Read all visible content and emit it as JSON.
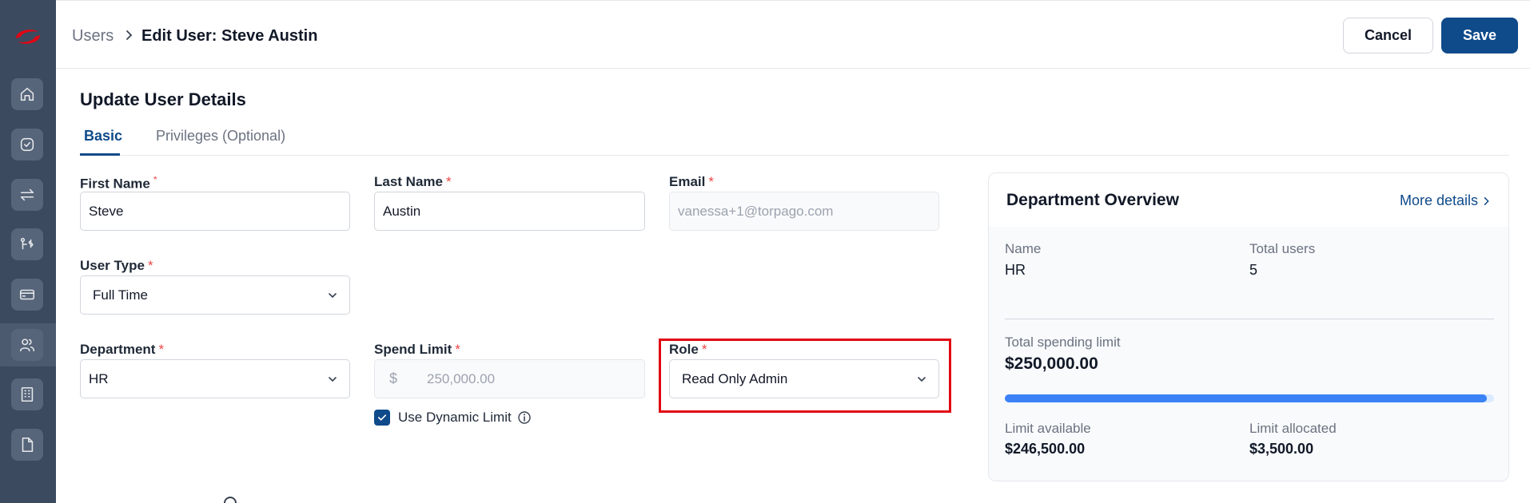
{
  "header": {
    "breadcrumb_root": "Users",
    "breadcrumb_current": "Edit User: Steve Austin",
    "cancel_label": "Cancel",
    "save_label": "Save"
  },
  "sidebar": {
    "items": [
      {
        "icon": "home-icon"
      },
      {
        "icon": "check-circle-icon"
      },
      {
        "icon": "transfer-icon"
      },
      {
        "icon": "routing-dollar-icon"
      },
      {
        "icon": "credit-card-icon"
      },
      {
        "icon": "users-icon",
        "active": true
      },
      {
        "icon": "building-icon"
      },
      {
        "icon": "document-icon"
      }
    ]
  },
  "form": {
    "title": "Update User Details",
    "tabs": [
      {
        "label": "Basic",
        "active": true
      },
      {
        "label": "Privileges (Optional)"
      }
    ],
    "first_name": {
      "label": "First Name",
      "value": "Steve"
    },
    "last_name": {
      "label": "Last Name",
      "value": "Austin"
    },
    "email": {
      "label": "Email",
      "value": "vanessa+1@torpago.com"
    },
    "user_type": {
      "label": "User Type",
      "value": "Full Time"
    },
    "department": {
      "label": "Department",
      "value": "HR"
    },
    "spend_limit": {
      "label": "Spend Limit",
      "currency": "$",
      "value": "250,000.00"
    },
    "dynamic_limit": {
      "label": "Use Dynamic Limit",
      "checked": true
    },
    "role": {
      "label": "Role",
      "value": "Read Only Admin"
    },
    "required_mark": "*"
  },
  "department_overview": {
    "title": "Department Overview",
    "more_link": "More details",
    "name_label": "Name",
    "name_value": "HR",
    "total_users_label": "Total users",
    "total_users_value": "5",
    "total_limit_label": "Total spending limit",
    "total_limit_value": "$250,000.00",
    "available_label": "Limit available",
    "available_value": "$246,500.00",
    "allocated_label": "Limit allocated",
    "allocated_value": "$3,500.00",
    "available_fraction": 0.986
  },
  "colors": {
    "accent": "#0f4a8a",
    "sidebar": "#3b4a5e",
    "required": "#ef4444",
    "highlight": "#e10613",
    "progress": "#3b82f6"
  }
}
